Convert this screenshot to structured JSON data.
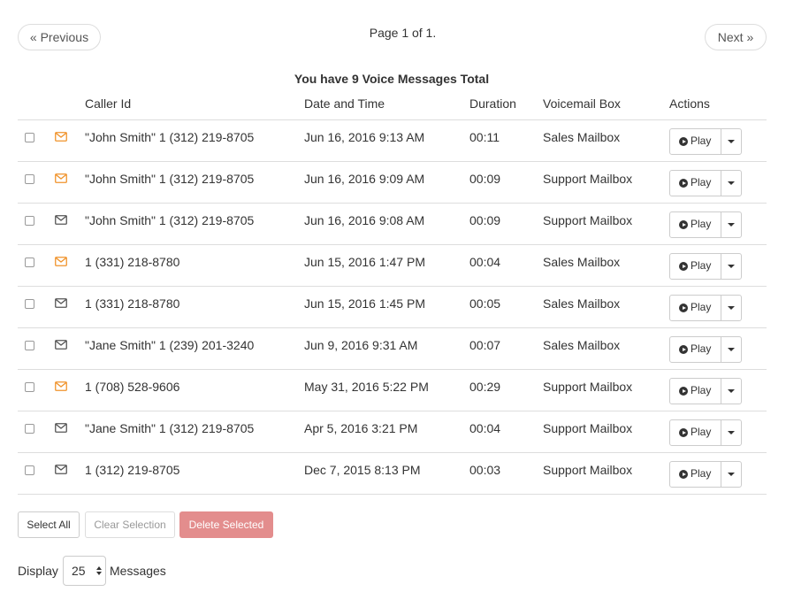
{
  "pager": {
    "previous": "« Previous",
    "page_info": "Page 1 of 1.",
    "next": "Next »"
  },
  "summary": "You have 9 Voice Messages Total",
  "columns": {
    "caller_id": "Caller Id",
    "date_time": "Date and Time",
    "duration": "Duration",
    "mailbox": "Voicemail Box",
    "actions": "Actions"
  },
  "colors": {
    "unread": "#f0932b",
    "read": "#555555",
    "delete": "#e38d8d"
  },
  "messages": [
    {
      "caller": "\"John Smith\" 1 (312) 219-8705",
      "date": "Jun 16, 2016 9:13 AM",
      "duration": "00:11",
      "mailbox": "Sales Mailbox",
      "unread": true,
      "play": "Play"
    },
    {
      "caller": "\"John Smith\" 1 (312) 219-8705",
      "date": "Jun 16, 2016 9:09 AM",
      "duration": "00:09",
      "mailbox": "Support Mailbox",
      "unread": true,
      "play": "Play"
    },
    {
      "caller": "\"John Smith\" 1 (312) 219-8705",
      "date": "Jun 16, 2016 9:08 AM",
      "duration": "00:09",
      "mailbox": "Support Mailbox",
      "unread": false,
      "play": "Play"
    },
    {
      "caller": "1 (331) 218-8780",
      "date": "Jun 15, 2016 1:47 PM",
      "duration": "00:04",
      "mailbox": "Sales Mailbox",
      "unread": true,
      "play": "Play"
    },
    {
      "caller": "1 (331) 218-8780",
      "date": "Jun 15, 2016 1:45 PM",
      "duration": "00:05",
      "mailbox": "Sales Mailbox",
      "unread": false,
      "play": "Play"
    },
    {
      "caller": "\"Jane Smith\" 1 (239) 201-3240",
      "date": "Jun 9, 2016 9:31 AM",
      "duration": "00:07",
      "mailbox": "Sales Mailbox",
      "unread": false,
      "play": "Play"
    },
    {
      "caller": "1 (708) 528-9606",
      "date": "May 31, 2016 5:22 PM",
      "duration": "00:29",
      "mailbox": "Support Mailbox",
      "unread": true,
      "play": "Play"
    },
    {
      "caller": "\"Jane Smith\" 1 (312) 219-8705",
      "date": "Apr 5, 2016 3:21 PM",
      "duration": "00:04",
      "mailbox": "Support Mailbox",
      "unread": false,
      "play": "Play"
    },
    {
      "caller": "1 (312) 219-8705",
      "date": "Dec 7, 2015 8:13 PM",
      "duration": "00:03",
      "mailbox": "Support Mailbox",
      "unread": false,
      "play": "Play"
    }
  ],
  "bulk_actions": {
    "select_all": "Select All",
    "clear_selection": "Clear Selection",
    "delete_selected": "Delete Selected"
  },
  "display": {
    "prefix": "Display",
    "value": "25",
    "suffix": "Messages"
  }
}
